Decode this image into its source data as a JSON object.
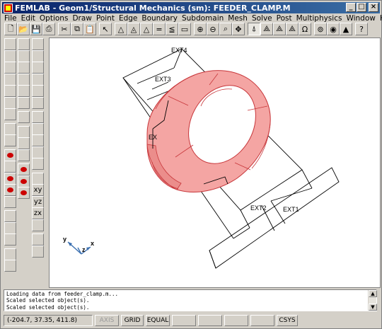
{
  "window": {
    "title": "FEMLAB - Geom1/Structural Mechanics (sm): FEEDER_CLAMP.M",
    "minimize_glyph": "_",
    "maximize_glyph": "□",
    "close_glyph": "×"
  },
  "menubar": {
    "items": [
      "File",
      "Edit",
      "Options",
      "Draw",
      "Point",
      "Edge",
      "Boundary",
      "Subdomain",
      "Mesh",
      "Solve",
      "Post",
      "Multiphysics",
      "Window",
      "Help"
    ]
  },
  "toolbar": {
    "buttons": [
      {
        "icon": "new-file-icon",
        "glyph": "🗋"
      },
      {
        "icon": "open-folder-icon",
        "glyph": "📂"
      },
      {
        "icon": "save-icon",
        "glyph": "💾"
      },
      {
        "icon": "print-icon",
        "glyph": "⎙"
      },
      {
        "icon": "cut-icon",
        "glyph": "✂"
      },
      {
        "icon": "copy-icon",
        "glyph": "⧉"
      },
      {
        "icon": "paste-icon",
        "glyph": "📋"
      },
      {
        "icon": "select-pointer-icon",
        "glyph": "↖"
      },
      {
        "icon": "point-mode-icon",
        "glyph": "△"
      },
      {
        "icon": "boundary-mode-icon",
        "glyph": "◬"
      },
      {
        "icon": "subdomain-mode-icon",
        "glyph": "△"
      },
      {
        "icon": "pde-coefficients-icon",
        "glyph": "="
      },
      {
        "icon": "boundary-settings-icon",
        "glyph": "≦"
      },
      {
        "icon": "subdomain-settings-icon",
        "glyph": "▭"
      },
      {
        "icon": "zoom-in-icon",
        "glyph": "⊕"
      },
      {
        "icon": "zoom-out-icon",
        "glyph": "⊖"
      },
      {
        "icon": "zoom-window-icon",
        "glyph": "⌕"
      },
      {
        "icon": "zoom-extents-icon",
        "glyph": "✥"
      },
      {
        "icon": "geometry-mode-icon",
        "glyph": "⍋"
      },
      {
        "icon": "init-mesh-icon",
        "glyph": "⟁"
      },
      {
        "icon": "refine-mesh-icon",
        "glyph": "⟁"
      },
      {
        "icon": "mesh-element-icon",
        "glyph": "⟁"
      },
      {
        "icon": "omega-icon",
        "glyph": "Ω"
      },
      {
        "icon": "solve-icon",
        "glyph": "⊚"
      },
      {
        "icon": "restart-icon",
        "glyph": "◉"
      },
      {
        "icon": "plot-icon",
        "glyph": "▲"
      },
      {
        "icon": "help-icon",
        "glyph": "?"
      }
    ]
  },
  "leftbar": {
    "col1": [
      "cube-icon",
      "block-icon",
      "cylinder-icon",
      "cone-icon",
      "sphere-icon",
      "torus-icon",
      "move-icon",
      "rotate-icon",
      "scale-icon",
      "red-dot",
      "eye-icon",
      "red-dot",
      "red-dot",
      "arrows-icon",
      "embed-icon",
      "extrude-icon",
      "revolve-icon",
      "pen-icon",
      "delete-icon"
    ],
    "col2": [
      "select-all-icon",
      "selection-icon",
      "union-icon",
      "intersection-icon",
      "difference-icon",
      "compose-icon",
      "lock-icon",
      "point-icon",
      "line-icon",
      "square-icon",
      "red-point",
      "red-line",
      "red-square"
    ],
    "col3": [
      "zoom-icon",
      "pan-icon",
      "orbit-icon",
      "magnify-icon",
      "zoom-in-icon",
      "zoom-out-icon",
      "undo-view-icon",
      "fit-icon",
      "headlight-icon",
      "light-icon",
      "box-icon",
      "cam-icon",
      "xy-icon",
      "yz-icon",
      "zx-icon",
      "tilt-icon",
      "layer1-icon",
      "layer2-icon"
    ],
    "labels": {
      "xy": "xy",
      "yz": "yz",
      "zx": "zx"
    }
  },
  "canvas": {
    "labels": {
      "ext4": "EXT4",
      "ext3": "EXT3",
      "ext_partial": "EX",
      "ext2": "EXT2",
      "ext1": "EXT1"
    },
    "axes": {
      "x": "x",
      "y": "y",
      "z": "z"
    },
    "colors": {
      "solid_fill": "#f4a5a3",
      "solid_edge": "#c7363a",
      "wire": "#000000"
    }
  },
  "console": {
    "lines": [
      "Loading data from feeder_clamp.m...",
      "Scaled selected object(s).",
      "Scaled selected object(s)."
    ]
  },
  "statusbar": {
    "coords": "(-204.7, 37.35, 411.8)",
    "buttons": [
      "AXIS",
      "GRID",
      "EQUAL",
      "",
      "",
      "",
      "",
      "CSYS"
    ]
  }
}
